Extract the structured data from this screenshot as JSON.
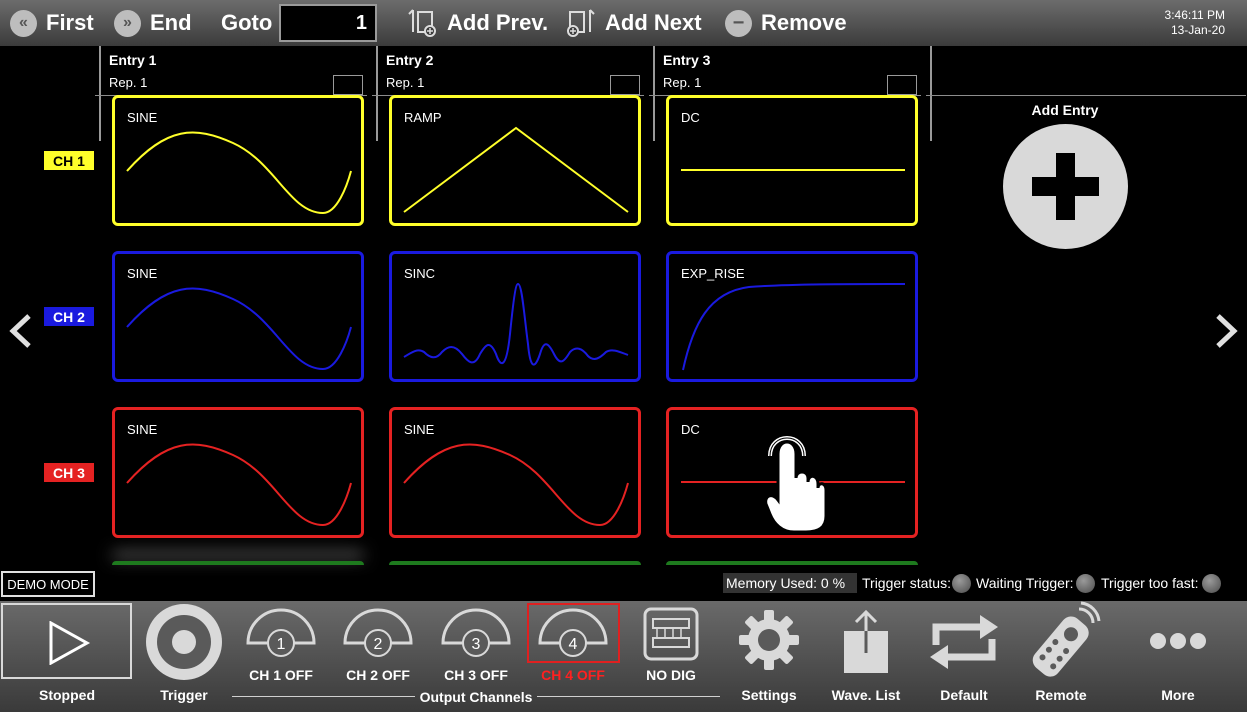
{
  "toolbar": {
    "first_label": "First",
    "end_label": "End",
    "goto_label": "Goto",
    "goto_value": "1",
    "add_prev_label": "Add Prev.",
    "add_next_label": "Add Next",
    "remove_label": "Remove",
    "time": "3:46:11 PM",
    "date": "13-Jan-20"
  },
  "entries": [
    {
      "title": "Entry  1",
      "rep": "Rep.  1"
    },
    {
      "title": "Entry  2",
      "rep": "Rep.  1"
    },
    {
      "title": "Entry  3",
      "rep": "Rep.  1"
    }
  ],
  "channels": [
    {
      "label": "CH 1",
      "color": "#ffff2a",
      "text_color": "#000000",
      "waves": [
        "SINE",
        "RAMP",
        "DC"
      ]
    },
    {
      "label": "CH 2",
      "color": "#1a1adf",
      "text_color": "#ffffff",
      "waves": [
        "SINE",
        "SINC",
        "EXP_RISE"
      ]
    },
    {
      "label": "CH 3",
      "color": "#e52222",
      "text_color": "#ffffff",
      "waves": [
        "SINE",
        "SINE",
        "DC"
      ]
    }
  ],
  "add_entry_label": "Add Entry",
  "status": {
    "demo_mode": "DEMO MODE",
    "memory_used": "Memory Used:  0 %",
    "trigger_status": "Trigger status:",
    "waiting_trigger": "Waiting Trigger:",
    "trigger_too_fast": "Trigger too fast:"
  },
  "bottom": {
    "stopped": "Stopped",
    "trigger": "Trigger",
    "ch1": "CH 1 OFF",
    "ch2": "CH 2 OFF",
    "ch3": "CH 3 OFF",
    "ch4": "CH 4 OFF",
    "no_dig": "NO DIG",
    "output_channels": "Output Channels",
    "settings": "Settings",
    "wave_list": "Wave. List",
    "default": "Default",
    "remote": "Remote",
    "more": "More",
    "ch_numbers": [
      "1",
      "2",
      "3",
      "4"
    ],
    "ch4_color": "#ff2020"
  },
  "icons": {
    "first": "double-chevron-left-icon",
    "end": "double-chevron-right-icon",
    "add_prev": "insert-before-icon",
    "add_next": "insert-after-icon",
    "remove": "minus-circle-icon",
    "add_entry": "plus-icon",
    "prev_page": "chevron-left-icon",
    "next_page": "chevron-right-icon",
    "stopped": "play-icon",
    "trigger": "record-icon",
    "channels": "half-circle-channel-icon",
    "no_dig": "digital-chip-icon",
    "settings": "gear-icon",
    "wave_list": "upload-icon",
    "default": "repeat-icon",
    "remote": "remote-control-icon",
    "more": "ellipsis-icon",
    "cursor": "hand-pointer-icon"
  }
}
